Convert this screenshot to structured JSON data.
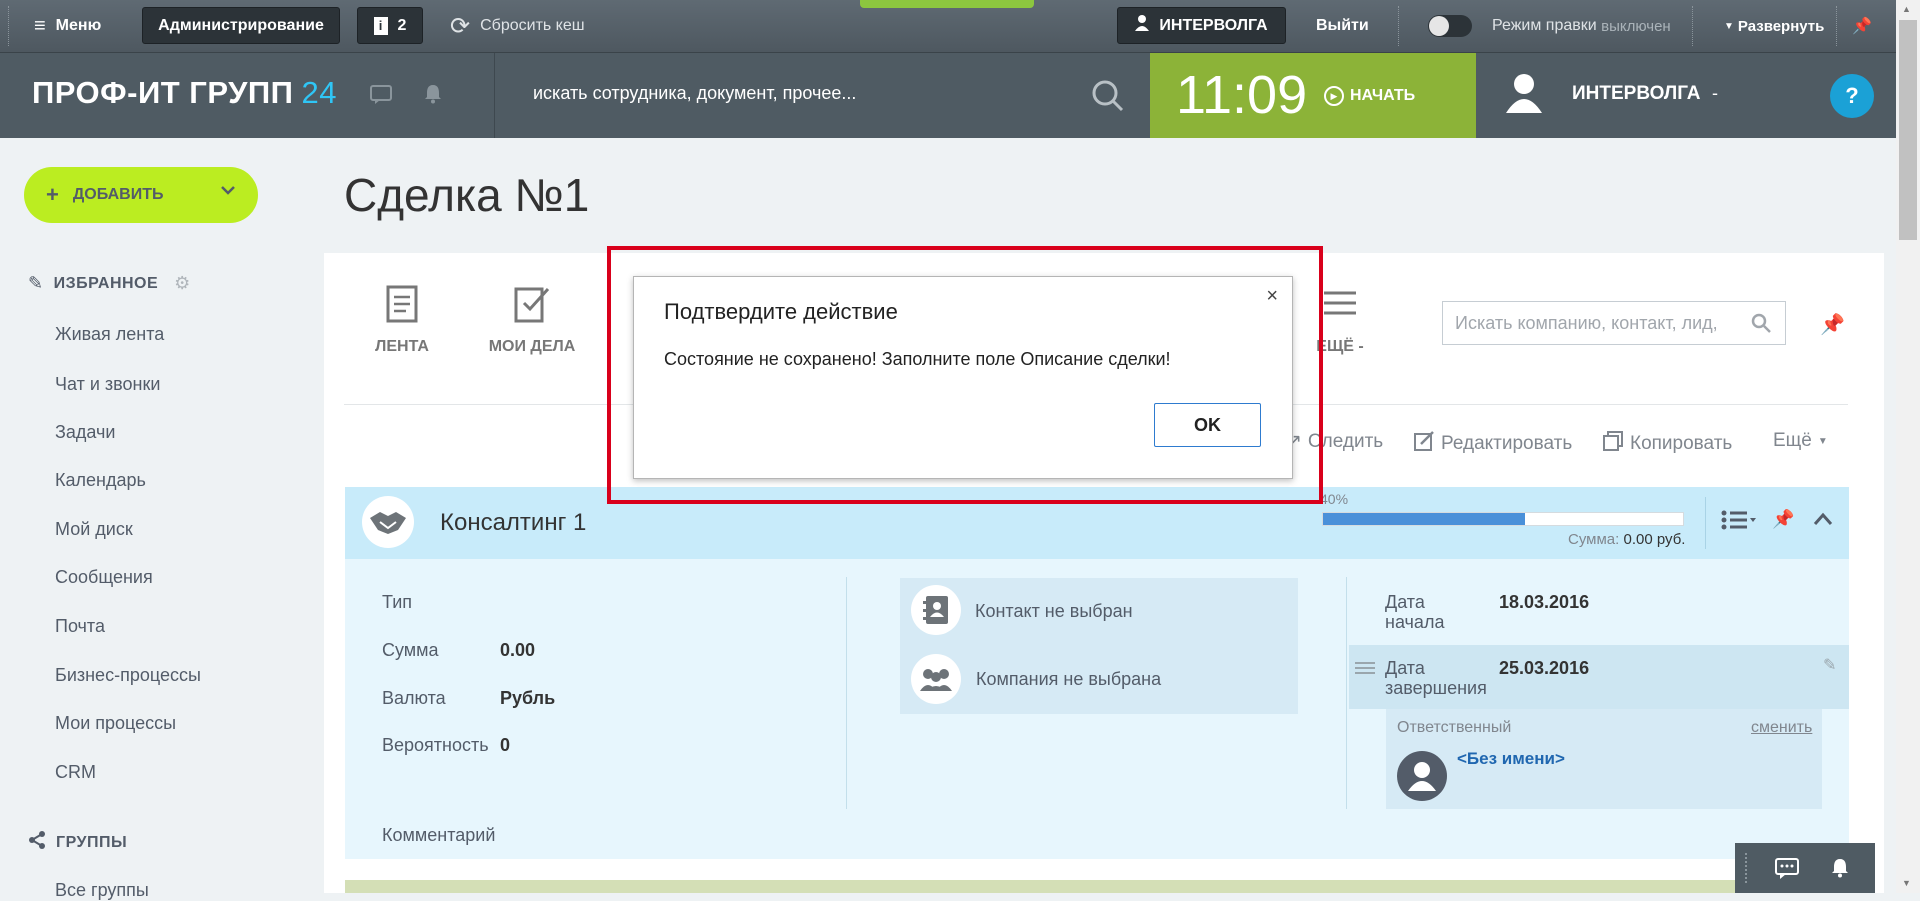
{
  "adminbar": {
    "menu": "Меню",
    "admin": "Администрирование",
    "notif_count": "2",
    "reset_cache": "Сбросить кеш",
    "company": "ИНТЕРВОЛГА",
    "logout": "Выйти",
    "edit_mode_label": "Режим правки",
    "edit_mode_state": "выключен",
    "expand": "Развернуть"
  },
  "header": {
    "logo": "ПРОФ-ИТ ГРУПП",
    "logo_num": "24",
    "search_placeholder": "искать сотрудника, документ, прочее...",
    "time": "11:09",
    "start": "НАЧАТЬ",
    "user": "ИНТЕРВОЛГА",
    "help": "?"
  },
  "sidebar": {
    "add": "ДОБАВИТЬ",
    "favorites": "ИЗБРАННОЕ",
    "items": [
      "Живая лента",
      "Чат и звонки",
      "Задачи",
      "Календарь",
      "Мой диск",
      "Сообщения",
      "Почта",
      "Бизнес-процессы",
      "Мои процессы",
      "CRM"
    ],
    "groups": "ГРУППЫ",
    "groups_item": "Все группы"
  },
  "page": {
    "title": "Сделка №1",
    "toolbar": {
      "feed": "ЛЕНТА",
      "my_tasks": "МОИ ДЕЛА",
      "more": "ЕЩЁ -"
    },
    "crm_search_placeholder": "Искать компанию, контакт, лид,",
    "actions": {
      "follow": "Следить",
      "edit": "Редактировать",
      "copy": "Копировать",
      "more": "Ещё"
    }
  },
  "deal": {
    "name": "Консалтинг 1",
    "progress_label": "40%",
    "progress": 0.56,
    "sum_label": "Сумма:",
    "sum_value": "0.00 руб.",
    "fields": {
      "type_label": "Тип",
      "sum_label": "Сумма",
      "sum": "0.00",
      "currency_label": "Валюта",
      "currency": "Рубль",
      "probability_label": "Вероятность",
      "probability": "0",
      "comment_label": "Комментарий"
    },
    "contact": "Контакт не выбран",
    "company": "Компания не выбрана",
    "start_label_1": "Дата",
    "start_label_2": "начала",
    "start_date": "18.03.2016",
    "end_label_1": "Дата",
    "end_label_2": "завершения",
    "end_date": "25.03.2016",
    "responsible_label": "Ответственный",
    "change": "сменить",
    "responsible_name": "<Без имени>"
  },
  "modal": {
    "title": "Подтвердите действие",
    "text": "Состояние не сохранено! Заполните поле Описание сделки!",
    "ok": "OK",
    "close": "×"
  },
  "colors": {
    "accent_green": "#8cb338",
    "add_button": "#bbed21",
    "deal_head": "#c8ebfa",
    "highlight_red": "#d9001b",
    "link_blue": "#2067b0"
  }
}
